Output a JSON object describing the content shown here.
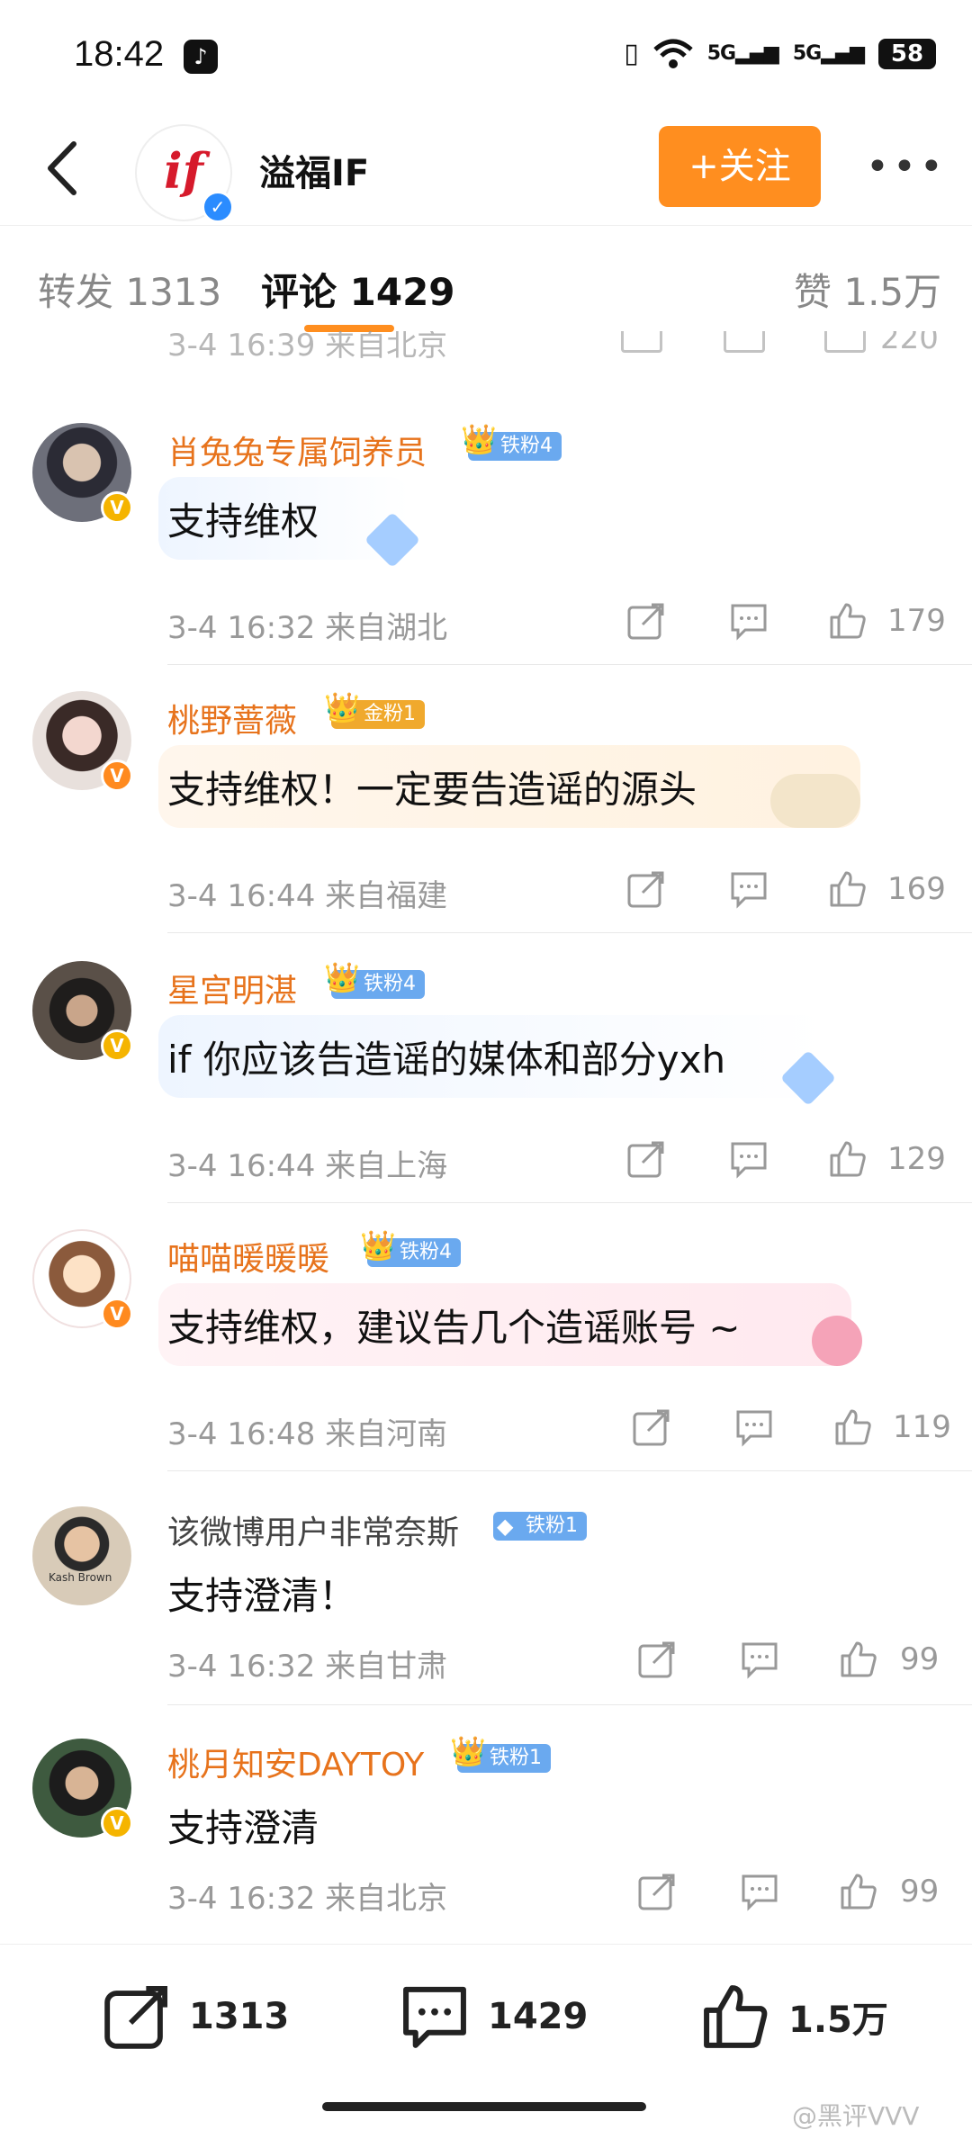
{
  "status_bar": {
    "time": "18:42",
    "battery": "58",
    "net1": "5G",
    "net2": "5G"
  },
  "header": {
    "account_name": "溢福IF",
    "follow_label": "+关注",
    "logo_text": "if"
  },
  "tabs": [
    {
      "label": "转发 1313"
    },
    {
      "label": "评论 1429"
    },
    {
      "label": "赞 1.5万"
    }
  ],
  "partial_row": {
    "meta": "3-4 16:39 来自北京",
    "likes": "220"
  },
  "comments": [
    {
      "username": "肖兔兔专属饲养员",
      "badge": "铁粉4",
      "text": "支持维权",
      "meta": "3-4 16:32 来自湖北",
      "likes": "179"
    },
    {
      "username": "桃野蔷薇",
      "badge": "金粉1",
      "text": "支持维权！一定要告造谣的源头",
      "meta": "3-4 16:44 来自福建",
      "likes": "169"
    },
    {
      "username": "星宫明湛",
      "badge": "铁粉4",
      "text": "if 你应该告造谣的媒体和部分yxh",
      "meta": "3-4 16:44 来自上海",
      "likes": "129"
    },
    {
      "username": "喵喵暖暖暖",
      "badge": "铁粉4",
      "text": "支持维权，建议告几个造谣账号 ~",
      "meta": "3-4 16:48 来自河南",
      "likes": "119"
    },
    {
      "username": "该微博用户非常奈斯",
      "badge": "铁粉1",
      "text": "支持澄清！",
      "meta": "3-4 16:32 来自甘肃",
      "likes": "99",
      "avatar_caption": "Kash Brown"
    },
    {
      "username": "桃月知安DAYTOY",
      "badge": "铁粉1",
      "text": "支持澄清",
      "meta": "3-4 16:32 来自北京",
      "likes": "99"
    }
  ],
  "bottom_bar": {
    "repost_count": "1313",
    "comment_count": "1429",
    "like_count": "1.5万"
  },
  "watermark": "@黑评VVV",
  "colors": {
    "accent": "#ff8e1f",
    "username_orange": "#e7731c",
    "verified_blue": "#2b8cff",
    "iron_badge": "#6aa9ef",
    "gold_badge": "#f0a92d"
  },
  "icons": [
    "back-icon",
    "more-icon",
    "share-icon",
    "comment-icon",
    "like-icon",
    "verified-icon",
    "crown-icon",
    "wifi-icon",
    "vibrate-icon"
  ]
}
